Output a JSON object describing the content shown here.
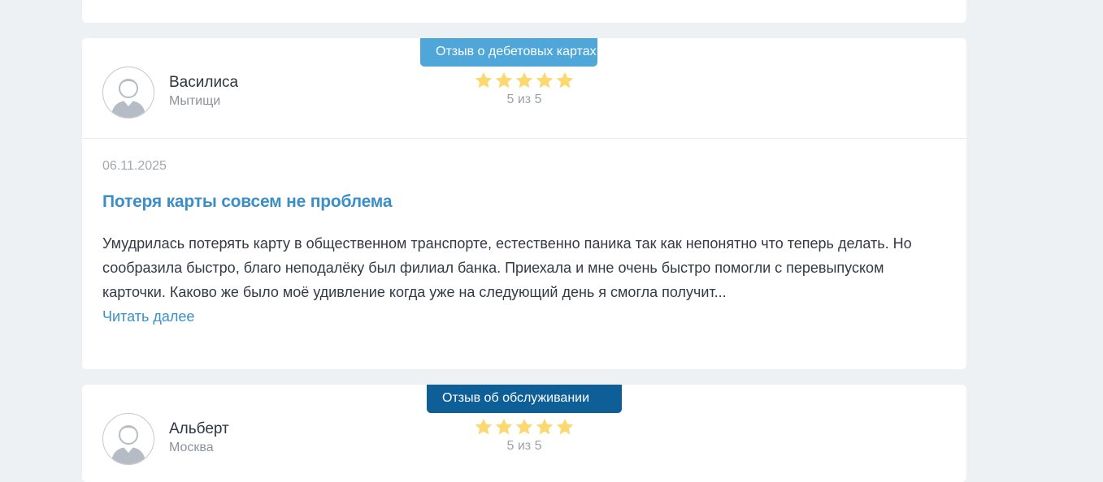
{
  "reviews": [
    {
      "badge": "Отзыв о дебетовых картах",
      "author_name": "Василиса",
      "author_city": "Мытищи",
      "stars_filled": 5,
      "stars_total": 5,
      "rating_text": "5 из 5",
      "date": "06.11.2025",
      "title": "Потеря карты совсем не проблема",
      "body": "Умудрилась потерять карту в общественном транспорте, естественно паника так как непонятно что теперь делать. Но сообразила быстро, благо неподалёку был филиал банка. Приехала и мне очень быстро помогли с перевыпуском карточки. Каково же было моё удивление когда уже на следующий день я смогла получит...",
      "read_more": "Читать далее"
    },
    {
      "badge": "Отзыв об обслуживании",
      "author_name": "Альберт",
      "author_city": "Москва",
      "stars_filled": 5,
      "stars_total": 5,
      "rating_text": "5 из 5"
    }
  ],
  "colors": {
    "page_bg": "#eef1f4",
    "star": "#fbd970",
    "link": "#3b8fc6",
    "badge_light": "#4fa6d8",
    "badge_dark": "#0e5f97"
  },
  "icons": {
    "avatar": "user-avatar-icon",
    "star": "star-icon"
  }
}
